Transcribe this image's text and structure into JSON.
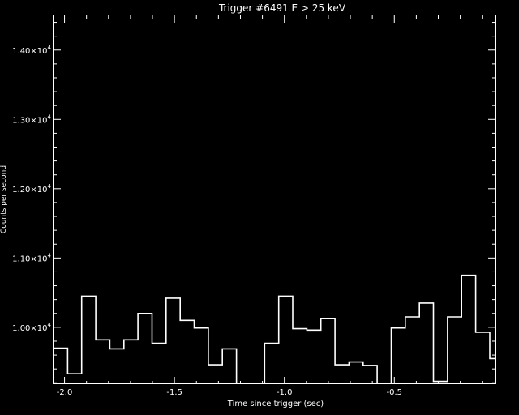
{
  "chart_data": {
    "type": "line",
    "title": "Trigger #6491  E > 25 keV",
    "xlabel": "Time since trigger (sec)",
    "ylabel": "Counts per second",
    "xlim": [
      -2.05,
      -0.04
    ],
    "ylim": [
      9180,
      14500
    ],
    "x_major_ticks": [
      {
        "value": -2.0,
        "label": "-2.0"
      },
      {
        "value": -1.5,
        "label": "-1.5"
      },
      {
        "value": -1.0,
        "label": "-1.0"
      },
      {
        "value": -0.5,
        "label": "-0.5"
      }
    ],
    "x_minor_step": 0.1,
    "y_major_ticks": [
      {
        "value": 10000,
        "mantissa": "1.00",
        "exp": "4"
      },
      {
        "value": 11000,
        "mantissa": "1.10",
        "exp": "4"
      },
      {
        "value": 12000,
        "mantissa": "1.20",
        "exp": "4"
      },
      {
        "value": 13000,
        "mantissa": "1.30",
        "exp": "4"
      },
      {
        "value": 14000,
        "mantissa": "1.40",
        "exp": "4"
      }
    ],
    "y_minor_step": 200,
    "bin_width": 0.064,
    "series": [
      {
        "bin_start": [
          -2.05,
          -1.986,
          -1.922,
          -1.858,
          -1.794,
          -1.73,
          -1.666,
          -1.602,
          -1.538,
          -1.474,
          -1.41,
          -1.346,
          -1.282,
          -1.218,
          -1.154,
          -1.09,
          -1.026,
          -0.962,
          -0.898,
          -0.834,
          -0.77,
          -0.706,
          -0.642,
          -0.578,
          -0.514,
          -0.45,
          -0.386,
          -0.322,
          -0.258,
          -0.194,
          -0.13,
          -0.066
        ],
        "values": [
          9700,
          9330,
          10450,
          9820,
          9690,
          9820,
          10200,
          9770,
          10420,
          10100,
          9990,
          9460,
          9690,
          9020,
          8870,
          9770,
          10450,
          9980,
          9960,
          10130,
          9460,
          9500,
          9450,
          9050,
          9990,
          10150,
          10350,
          9220,
          10150,
          10750,
          9930,
          9550
        ]
      }
    ]
  }
}
